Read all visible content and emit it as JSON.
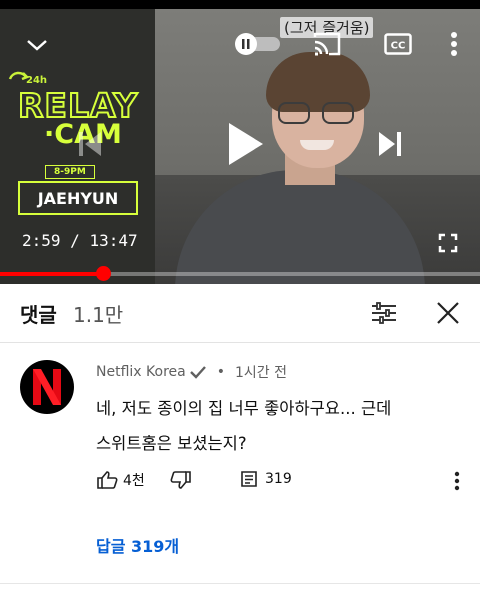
{
  "player": {
    "graphic": {
      "badge_24h": "24h",
      "relay_text": "RELAY",
      "cam_text": "·CAM",
      "time_slot": "8-9PM",
      "name": "JAEHYUN"
    },
    "caption_overlay": "(그저 즐거움)",
    "current_time": "2:59",
    "duration": "13:47",
    "time_separator": "/",
    "progress_fraction": 0.215,
    "accent_color": "#ff0000",
    "icons": [
      "chevron-down-icon",
      "autoplay-toggle-icon",
      "cast-icon",
      "cc-icon",
      "more-vert-icon",
      "previous-icon",
      "play-icon",
      "next-icon",
      "fullscreen-icon"
    ]
  },
  "comments_header": {
    "title": "댓글",
    "count": "1.1만"
  },
  "comment": {
    "author": "Netflix Korea",
    "verified": true,
    "bullet": "•",
    "time_ago": "1시간 전",
    "text_line1": "네, 저도 종이의 집 너무 좋아하구요... 근데",
    "text_line2": "스위트홈은 보셨는지?",
    "likes": "4천",
    "reply_count": "319",
    "replies_link": "답글 319개",
    "avatar_letter": "N",
    "avatar_color": "#e50914"
  }
}
